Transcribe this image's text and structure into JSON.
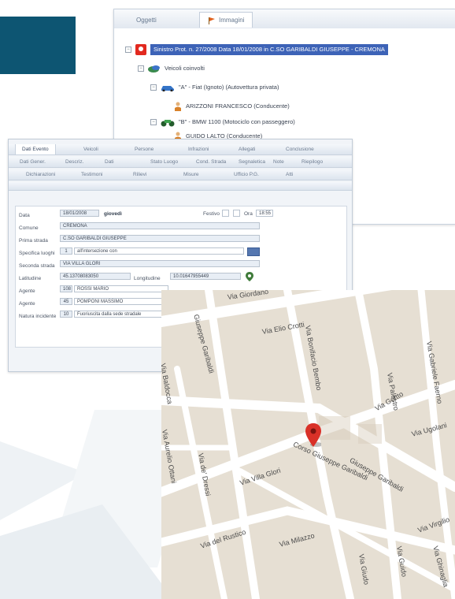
{
  "tree_window": {
    "tabs": [
      "Oggetti",
      "Immagini"
    ],
    "root": "Sinistro Prot. n. 27/2008 Data 18/01/2008 in C.SO GARIBALDI GIUSEPPE - CREMONA",
    "group": "Veicoli coinvolti",
    "items": [
      {
        "label": "\"A\" - Fiat (Ignoto) (Autovettura privata)"
      },
      {
        "label": "ARIZZONI FRANCESCO (Conducente)"
      },
      {
        "label": "\"B\" - BMW 1100 (Motociclo con passeggero)"
      },
      {
        "label": "GUIDO LALTO (Conducente)"
      }
    ]
  },
  "form_window": {
    "menu1": [
      "Dati Evento",
      "Veicoli",
      "Persone",
      "Infrazioni",
      "Allegati",
      "Conclusione"
    ],
    "menu2": [
      "Dati Gener.",
      "Descriz.",
      "Dati",
      "Stato Luogo",
      "Cond. Strada",
      "Segnaletica",
      "Note",
      "Riepilogo"
    ],
    "menu3": [
      "Dichiarazioni",
      "Testimoni",
      "Rilievi",
      "Misure",
      "Ufficio P.G.",
      "Atti"
    ],
    "fields": {
      "data_label": "Data",
      "data_value": "18/01/2008",
      "data_status": "giovedì",
      "festivo_label": "Festivo",
      "ora_label": "Ora",
      "ora_value": "18:55",
      "comune_label": "Comune",
      "comune_value": "CREMONA",
      "strada_label": "Prima strada",
      "strada_value": "C.SO GARIBALDI GIUSEPPE",
      "specifica_label": "Specifica luoghi",
      "specifica_code": "1",
      "specifica_value": "all'intersezione con",
      "seconda_label": "Seconda strada",
      "seconda_value": "VIA VILLA GLORI",
      "latitudine_label": "Latitudine",
      "latitudine_value": "45.13708083050",
      "longitudine_label": "Longitudine",
      "longitudine_value": "10.01647955449",
      "agente1_label": "Agente",
      "agente1_code": "108",
      "agente1_value": "ROSSI MARIO",
      "agente2_label": "Agente",
      "agente2_code": "45",
      "agente2_value": "POMPONI MASSIMO",
      "natura_label": "Natura incidente",
      "natura_code": "10",
      "natura_value": "Fuoriuscita dalla sede stradale"
    }
  },
  "map": {
    "streets": [
      "Via Elio Crotti",
      "Via Bonifacio Bembo",
      "Via Giordano",
      "Giuseppe Garibaldi",
      "Via Baldocca",
      "Via Aurelio Ottani",
      "Via de' Dressi",
      "Via Villa Glori",
      "Via del Rustico",
      "Via Milazzo",
      "Via Giudo",
      "Corso Giuseppe Garibaldi",
      "Via Gottto",
      "Via Palestro",
      "Via Ugolani",
      "Via Gabriele Faerno",
      "Via Virgilio",
      "Via Ghinaglia",
      "Via Guido",
      "Giuseppe Garibaldi"
    ]
  },
  "colors": {
    "accent": "#0d5572",
    "pin": "#d93128",
    "map_bg": "#e6dfd3"
  }
}
